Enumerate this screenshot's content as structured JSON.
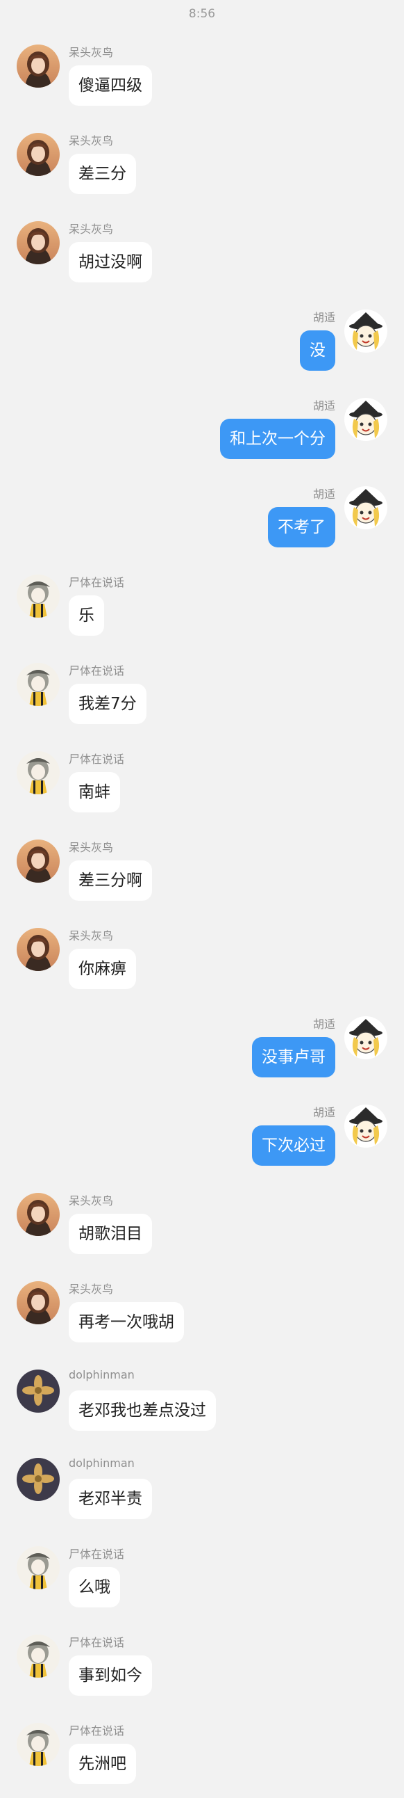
{
  "status_time": "8:56",
  "messages": [
    {
      "side": "left",
      "avatar": "girl",
      "name": "呆头灰鸟",
      "text": "傻逼四级"
    },
    {
      "side": "left",
      "avatar": "girl",
      "name": "呆头灰鸟",
      "text": "差三分"
    },
    {
      "side": "left",
      "avatar": "girl",
      "name": "呆头灰鸟",
      "text": "胡过没啊"
    },
    {
      "side": "right",
      "avatar": "witch",
      "name": "胡适",
      "text": "没"
    },
    {
      "side": "right",
      "avatar": "witch",
      "name": "胡适",
      "text": "和上次一个分"
    },
    {
      "side": "right",
      "avatar": "witch",
      "name": "胡适",
      "text": "不考了"
    },
    {
      "side": "left",
      "avatar": "ghost",
      "name": "尸体在说话",
      "text": "乐"
    },
    {
      "side": "left",
      "avatar": "ghost",
      "name": "尸体在说话",
      "text": "我差7分"
    },
    {
      "side": "left",
      "avatar": "ghost",
      "name": "尸体在说话",
      "text": "南蚌"
    },
    {
      "side": "left",
      "avatar": "girl",
      "name": "呆头灰鸟",
      "text": "差三分啊"
    },
    {
      "side": "left",
      "avatar": "girl",
      "name": "呆头灰鸟",
      "text": "你麻痹"
    },
    {
      "side": "right",
      "avatar": "witch",
      "name": "胡适",
      "text": "没事卢哥"
    },
    {
      "side": "right",
      "avatar": "witch",
      "name": "胡适",
      "text": "下次必过"
    },
    {
      "side": "left",
      "avatar": "girl",
      "name": "呆头灰鸟",
      "text": "胡歌泪目"
    },
    {
      "side": "left",
      "avatar": "girl",
      "name": "呆头灰鸟",
      "text": "再考一次哦胡"
    },
    {
      "side": "left",
      "avatar": "dolphin",
      "name": "dolphinman",
      "text": "老邓我也差点没过"
    },
    {
      "side": "left",
      "avatar": "dolphin",
      "name": "dolphinman",
      "text": "老邓半责"
    },
    {
      "side": "left",
      "avatar": "ghost",
      "name": "尸体在说话",
      "text": "么哦"
    },
    {
      "side": "left",
      "avatar": "ghost",
      "name": "尸体在说话",
      "text": "事到如今"
    },
    {
      "side": "left",
      "avatar": "ghost",
      "name": "尸体在说话",
      "text": "先洲吧"
    }
  ],
  "avatar_icons": {
    "girl": "girl-avatar-icon",
    "witch": "witch-avatar-icon",
    "ghost": "ghost-girl-avatar-icon",
    "dolphin": "flower-avatar-icon"
  }
}
